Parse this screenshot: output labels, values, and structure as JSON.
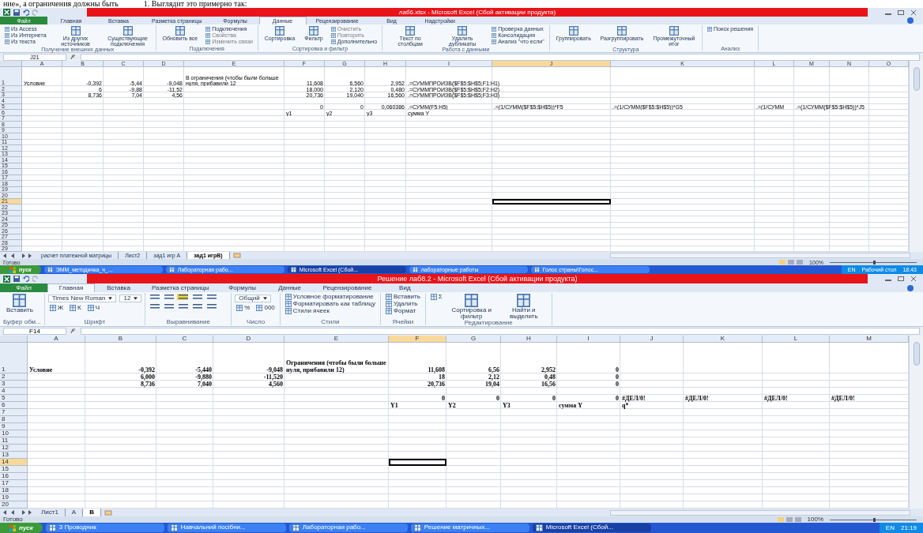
{
  "doc_text": [
    "ние», а ограничения должны быть",
    "1. Выглядит это примерно так:"
  ],
  "windows": [
    {
      "title": "лаб6.xlsx  -  Microsoft Excel (Сбой активации продукта)",
      "ribbon_tabs": [
        {
          "label": "Файл",
          "selected": false
        },
        {
          "label": "Главная",
          "selected": false
        },
        {
          "label": "Вставка",
          "selected": false
        },
        {
          "label": "Разметка страницы",
          "selected": false
        },
        {
          "label": "Формулы",
          "selected": false
        },
        {
          "label": "Данные",
          "selected": true
        },
        {
          "label": "Рецензирование",
          "selected": false
        },
        {
          "label": "Вид",
          "selected": false
        },
        {
          "label": "Надстройки",
          "selected": false
        }
      ],
      "ribbon_groups": [
        {
          "label": "Получение внешних данных",
          "items": [
            {
              "kind": "stack",
              "items": [
                {
                  "label": "Из Access",
                  "kind": "small",
                  "disabled": false
                },
                {
                  "label": "Из Интернета",
                  "kind": "small",
                  "disabled": false
                },
                {
                  "label": "Из текста",
                  "kind": "small",
                  "disabled": false
                }
              ]
            },
            {
              "label": "Из других источников",
              "kind": "large",
              "disabled": false
            },
            {
              "label": "Существующие подключения",
              "kind": "large",
              "disabled": false
            }
          ]
        },
        {
          "label": "Подключения",
          "items": [
            {
              "label": "Обновить все",
              "kind": "large",
              "disabled": false
            },
            {
              "label": "Подключения",
              "kind": "small",
              "disabled": false
            },
            {
              "label": "Свойства",
              "kind": "small",
              "disabled": true
            },
            {
              "label": "Изменить связи",
              "kind": "small",
              "disabled": true
            }
          ]
        },
        {
          "label": "Сортировка и фильтр",
          "items": [
            {
              "label": "Сортировка",
              "kind": "large",
              "disabled": false
            },
            {
              "label": "Фильтр",
              "kind": "large",
              "disabled": false
            },
            {
              "label": "Очистить",
              "kind": "small",
              "disabled": true
            },
            {
              "label": "Повторить",
              "kind": "small",
              "disabled": true
            },
            {
              "label": "Дополнительно",
              "kind": "small",
              "disabled": false
            }
          ]
        },
        {
          "label": "Работа с данными",
          "items": [
            {
              "label": "Текст по столбцам",
              "kind": "large",
              "disabled": false
            },
            {
              "label": "Удалить дубликаты",
              "kind": "large",
              "disabled": false
            },
            {
              "kind": "stack",
              "items": [
                {
                  "label": "Проверка данных",
                  "kind": "small",
                  "disabled": false
                },
                {
                  "label": "Консолидация",
                  "kind": "small",
                  "disabled": false
                },
                {
                  "label": "Анализ \"что если\"",
                  "kind": "small",
                  "disabled": false
                }
              ]
            }
          ]
        },
        {
          "label": "Структура",
          "items": [
            {
              "label": "Группировать",
              "kind": "large",
              "disabled": false
            },
            {
              "label": "Разгруппировать",
              "kind": "large",
              "disabled": false
            },
            {
              "label": "Промежуточный итог",
              "kind": "large",
              "disabled": false
            }
          ]
        },
        {
          "label": "Анализ",
          "items": [
            {
              "label": "Поиск решения",
              "kind": "small",
              "disabled": false
            }
          ]
        }
      ],
      "name_box": "J21",
      "columns": [
        {
          "label": "A",
          "selected": false
        },
        {
          "label": "B",
          "selected": false
        },
        {
          "label": "C",
          "selected": false
        },
        {
          "label": "D",
          "selected": false
        },
        {
          "label": "E",
          "selected": false
        },
        {
          "label": "F",
          "selected": false
        },
        {
          "label": "G",
          "selected": false
        },
        {
          "label": "H",
          "selected": false
        },
        {
          "label": "I",
          "selected": false
        },
        {
          "label": "J",
          "selected": true
        },
        {
          "label": "K",
          "selected": false
        },
        {
          "label": "L",
          "selected": false
        },
        {
          "label": "M",
          "selected": false
        },
        {
          "label": "N",
          "selected": false
        },
        {
          "label": "O",
          "selected": false
        }
      ],
      "rows": [
        {
          "num": "1",
          "selected": false,
          "cells": [
            "Условие",
            "-0,392",
            "-5,44",
            "-9,048",
            {
              "text": "В ограничения (чтобы были больше нуля, прибавили 12",
              "wrap": true
            },
            "11,608",
            "6,560",
            "2,952",
            ".=СУММПРОИЗВ($F$5:$H$5;F1:H1)",
            null,
            null,
            null,
            null,
            null,
            null
          ]
        },
        {
          "num": "2",
          "selected": false,
          "cells": [
            null,
            "6",
            "-9,88",
            "-11,52",
            null,
            "18,000",
            "2,120",
            "0,480",
            ".=СУММПРОИЗВ($F$5:$H$5;F2:H2)",
            null,
            null,
            null,
            null,
            null,
            null
          ]
        },
        {
          "num": "3",
          "selected": false,
          "cells": [
            null,
            "8,736",
            "7,04",
            "4,56",
            null,
            "20,736",
            "19,040",
            "16,560",
            ".=СУММПРОИЗВ($F$5:$H$5;F3:H3)",
            null,
            null,
            null,
            null,
            null,
            null
          ]
        },
        {
          "num": "4",
          "selected": false
        },
        {
          "num": "5",
          "selected": false,
          "cells": [
            null,
            null,
            null,
            null,
            null,
            "0",
            "0",
            "0,060386",
            ".=СУММ(F5:H5)",
            ".=(1/СУММ($F$5:$H$5))*F5",
            ".=(1/СУММ($F$5:$H$5))*G5",
            ".=(1/СУММ",
            ".=(1/СУММ($F$5:$H$5))*J5",
            null,
            null
          ]
        },
        {
          "num": "6",
          "selected": false,
          "cells": [
            null,
            null,
            null,
            null,
            null,
            "у1",
            "у2",
            "у3",
            "сумма Y",
            null,
            null,
            null,
            null,
            null,
            null
          ]
        },
        {
          "num": "7",
          "selected": false
        },
        {
          "num": "8",
          "selected": false
        },
        {
          "num": "9",
          "selected": false
        },
        {
          "num": "10",
          "selected": false
        },
        {
          "num": "11",
          "selected": false
        },
        {
          "num": "12",
          "selected": false
        },
        {
          "num": "13",
          "selected": false
        },
        {
          "num": "14",
          "selected": false
        },
        {
          "num": "15",
          "selected": false
        },
        {
          "num": "16",
          "selected": false
        },
        {
          "num": "17",
          "selected": false
        },
        {
          "num": "18",
          "selected": false
        },
        {
          "num": "19",
          "selected": false
        },
        {
          "num": "20",
          "selected": false
        },
        {
          "num": "21",
          "selected": true
        },
        {
          "num": "22",
          "selected": false
        },
        {
          "num": "23",
          "selected": false
        },
        {
          "num": "24",
          "selected": false
        },
        {
          "num": "25",
          "selected": false
        },
        {
          "num": "26",
          "selected": false
        },
        {
          "num": "27",
          "selected": false
        },
        {
          "num": "28",
          "selected": false
        },
        {
          "num": "29",
          "selected": false
        }
      ],
      "sheet_tabs": [
        {
          "label": "расчет платежной матрицы",
          "selected": false
        },
        {
          "label": "Лист2",
          "selected": false
        },
        {
          "label": "зад1 игр А",
          "selected": false
        },
        {
          "label": "зад1 игрВ)",
          "selected": true
        }
      ],
      "status": "Готово",
      "zoom": {
        "label": "100%",
        "level": 0.5
      },
      "taskbar": {
        "start": "пуск",
        "items": [
          {
            "label": "ЭММ_методичка_ч_...",
            "selected": false
          },
          {
            "label": "Лабораторная рабо...",
            "selected": false
          },
          {
            "label": "Microsoft Excel (Сбой...",
            "selected": true
          },
          {
            "label": "лабораторные работы",
            "selected": false
          },
          {
            "label": "Голос страны\\Голос...",
            "selected": false
          }
        ],
        "tray": [
          "EN",
          "Рабочий стол"
        ],
        "time": "18:43"
      }
    },
    {
      "title": "Решение лаб8.2  -  Microsoft Excel (Сбой активации продукта)",
      "ribbon_tabs": [
        {
          "label": "Файл",
          "selected": false
        },
        {
          "label": "Главная",
          "selected": true
        },
        {
          "label": "Вставка",
          "selected": false
        },
        {
          "label": "Разметка страницы",
          "selected": false
        },
        {
          "label": "Формулы",
          "selected": false
        },
        {
          "label": "Данные",
          "selected": false
        },
        {
          "label": "Рецензирование",
          "selected": false
        },
        {
          "label": "Вид",
          "selected": false
        }
      ],
      "ribbon_groups": [
        {
          "label": "Буфер обм...",
          "items": [
            {
              "label": "Вставить",
              "kind": "large",
              "disabled": false
            }
          ]
        },
        {
          "label": "Шрифт",
          "items": [
            {
              "label": "Times New Roman",
              "kind": "field",
              "disabled": false
            },
            {
              "label": "12",
              "kind": "field",
              "disabled": false
            },
            {
              "label": "Ж",
              "kind": "small",
              "disabled": false
            },
            {
              "label": "К",
              "kind": "small",
              "disabled": false
            },
            {
              "label": "Ч",
              "kind": "small",
              "disabled": false
            }
          ]
        },
        {
          "label": "Выравнивание",
          "items": [
            {
              "kind": "align",
              "disabled": false
            }
          ]
        },
        {
          "label": "Число",
          "items": [
            {
              "label": "Общий",
              "kind": "field",
              "disabled": false
            },
            {
              "label": "%",
              "kind": "small",
              "disabled": false
            },
            {
              "label": "000",
              "kind": "small",
              "disabled": false
            }
          ]
        },
        {
          "label": "Стили",
          "items": [
            {
              "label": "Условное форматирование",
              "kind": "small",
              "disabled": false
            },
            {
              "label": "Форматировать как таблицу",
              "kind": "small",
              "disabled": false
            },
            {
              "label": "Стили ячеек",
              "kind": "small",
              "disabled": false
            }
          ]
        },
        {
          "label": "Ячейки",
          "items": [
            {
              "label": "Вставить",
              "kind": "small",
              "disabled": false
            },
            {
              "label": "Удалить",
              "kind": "small",
              "disabled": false
            },
            {
              "label": "Формат",
              "kind": "small",
              "disabled": false
            }
          ]
        },
        {
          "label": "Редактирование",
          "items": [
            {
              "label": "Σ",
              "kind": "small",
              "disabled": false
            },
            {
              "label": "Сортировка и фильтр",
              "kind": "large",
              "disabled": false
            },
            {
              "label": "Найти и выделить",
              "kind": "large",
              "disabled": false
            }
          ]
        }
      ],
      "name_box": "F14",
      "columns": [
        {
          "label": "A",
          "selected": false
        },
        {
          "label": "B",
          "selected": false
        },
        {
          "label": "C",
          "selected": false
        },
        {
          "label": "D",
          "selected": false
        },
        {
          "label": "E",
          "selected": false
        },
        {
          "label": "F",
          "selected": true
        },
        {
          "label": "G",
          "selected": false
        },
        {
          "label": "H",
          "selected": false
        },
        {
          "label": "I",
          "selected": false
        },
        {
          "label": "J",
          "selected": false
        },
        {
          "label": "K",
          "selected": false
        },
        {
          "label": "L",
          "selected": false
        },
        {
          "label": "M",
          "selected": false
        }
      ],
      "rows": [
        {
          "num": "1",
          "selected": false,
          "cells": [
            "Условие",
            "-0,392",
            "-5,440",
            "-9,048",
            {
              "text": "Ограничения (чтобы были больше нуля, прибавили 12)",
              "wrap": true
            },
            "11,608",
            "6,56",
            "2,952",
            "0",
            null,
            null,
            null,
            null
          ]
        },
        {
          "num": "2",
          "selected": false,
          "cells": [
            null,
            "6,000",
            "-9,880",
            "-11,520",
            null,
            "18",
            "2,12",
            "0,48",
            "0",
            null,
            null,
            null,
            null
          ]
        },
        {
          "num": "3",
          "selected": false,
          "cells": [
            null,
            "8,736",
            "7,040",
            "4,560",
            null,
            "20,736",
            "19,04",
            "16,56",
            "0",
            null,
            null,
            null,
            null
          ]
        },
        {
          "num": "4",
          "selected": false
        },
        {
          "num": "5",
          "selected": false,
          "cells": [
            null,
            null,
            null,
            null,
            null,
            "0",
            "0",
            "0",
            "0",
            "#ДЕЛ/0!",
            "#ДЕЛ/0!",
            "#ДЕЛ/0!",
            "#ДЕЛ/0!"
          ]
        },
        {
          "num": "6",
          "selected": false,
          "cells": [
            null,
            null,
            null,
            null,
            null,
            "Y1",
            "Y2",
            "Y3",
            "сумма Y",
            "q*",
            null,
            null,
            null
          ]
        },
        {
          "num": "7",
          "selected": false
        },
        {
          "num": "8",
          "selected": false
        },
        {
          "num": "9",
          "selected": false
        },
        {
          "num": "10",
          "selected": false
        },
        {
          "num": "11",
          "selected": false
        },
        {
          "num": "12",
          "selected": false
        },
        {
          "num": "13",
          "selected": false
        },
        {
          "num": "14",
          "selected": true
        },
        {
          "num": "15",
          "selected": false
        },
        {
          "num": "16",
          "selected": false
        },
        {
          "num": "17",
          "selected": false
        },
        {
          "num": "18",
          "selected": false
        },
        {
          "num": "19",
          "selected": false
        },
        {
          "num": "20",
          "selected": false
        }
      ],
      "sheet_tabs": [
        {
          "label": "Лист1",
          "selected": false
        },
        {
          "label": "А",
          "selected": false
        },
        {
          "label": "В",
          "selected": true
        }
      ],
      "status": "Готово",
      "zoom": {
        "label": "100%",
        "level": 0.5
      },
      "taskbar": {
        "start": "пуск",
        "items": [
          {
            "label": "3 Проводник",
            "selected": false
          },
          {
            "label": "Навчальний посібни...",
            "selected": false
          },
          {
            "label": "Лабораторная рабо...",
            "selected": false
          },
          {
            "label": "Решение матричных...",
            "selected": false
          },
          {
            "label": "Microsoft Excel (Сбой...",
            "selected": true
          }
        ],
        "tray": [
          "EN"
        ],
        "time": "21:19"
      }
    }
  ]
}
